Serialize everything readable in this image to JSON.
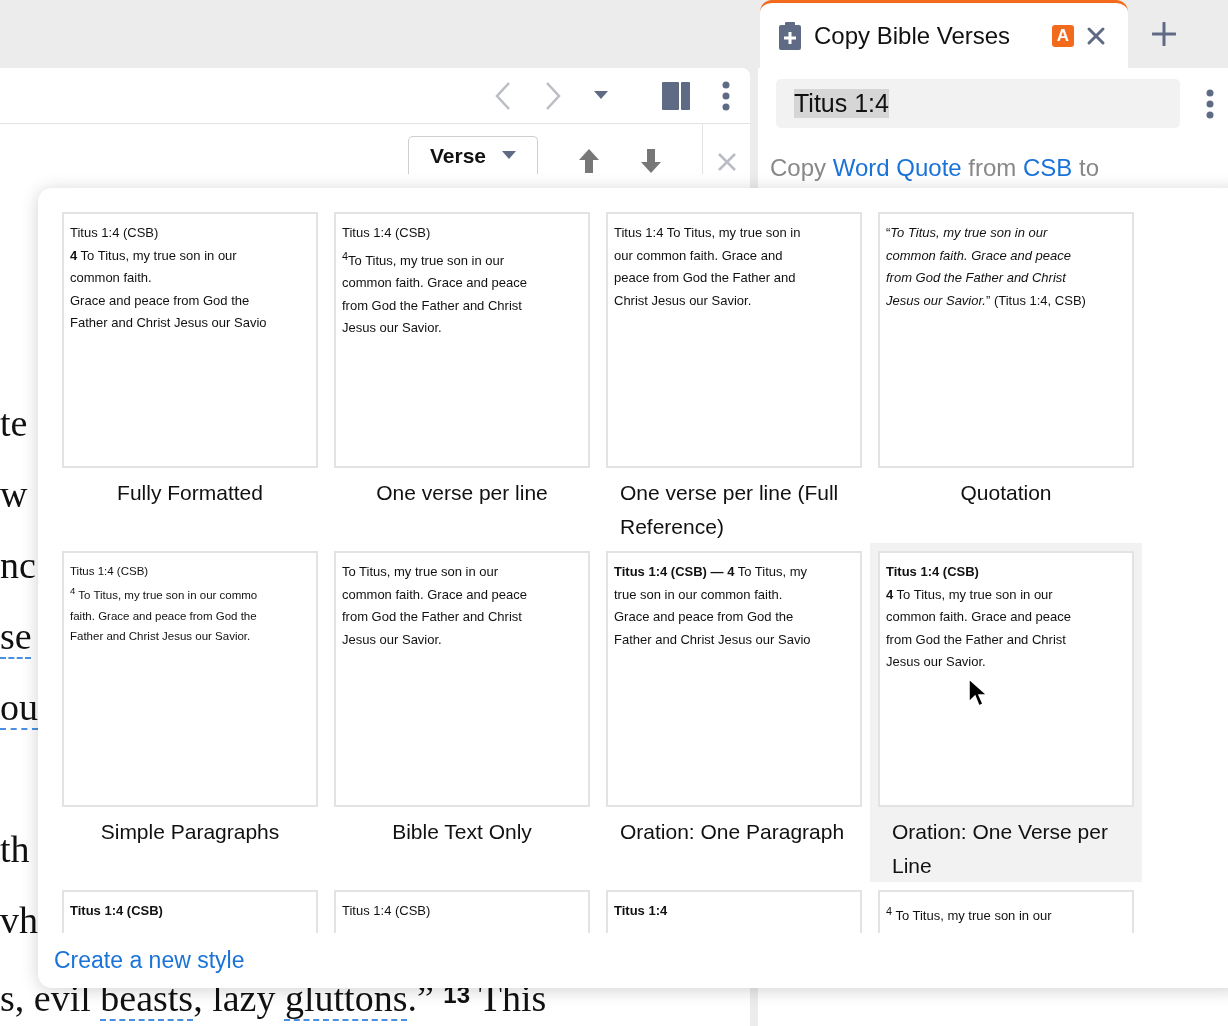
{
  "tab_strip": {
    "tab": {
      "title": "Copy Bible Verses",
      "badge": "A",
      "selected": true
    }
  },
  "left_panel": {
    "verse_dropdown": "Verse",
    "document": {
      "paragraphs": [
        {
          "lines": [
            {
              "text": "te",
              "linked": false
            },
            {
              "text": "w",
              "linked": false
            },
            {
              "text": "nc",
              "linked": false
            },
            {
              "text": "se",
              "linked": true
            },
            {
              "text": "ou",
              "linked": true
            }
          ]
        },
        {
          "lines": [
            {
              "text": "th",
              "linked": false
            },
            {
              "text": "vh",
              "linked": false
            }
          ]
        }
      ],
      "last_line": [
        {
          "text": "s, evil ",
          "kind": "plain"
        },
        {
          "text": "beasts",
          "kind": "link"
        },
        {
          "text": ", lazy ",
          "kind": "plain"
        },
        {
          "text": "gluttons",
          "kind": "link"
        },
        {
          "text": ".” ",
          "kind": "plain"
        },
        {
          "text": "13",
          "kind": "verse"
        },
        {
          "text": " This",
          "kind": "plain"
        }
      ]
    }
  },
  "right_panel": {
    "reference_field": {
      "value": "Titus 1:4",
      "text_selected": true
    },
    "copy_sentence": [
      {
        "text": "Copy",
        "link": false
      },
      {
        "text": "Word Quote",
        "link": true
      },
      {
        "text": "from",
        "link": false
      },
      {
        "text": "CSB",
        "link": true
      },
      {
        "text": "to",
        "link": false
      }
    ]
  },
  "style_picker": {
    "styles": [
      {
        "name": "Fully Formatted",
        "selected": false,
        "compact": false,
        "preview": [
          "Titus 1:4 (CSB)",
          "**4** To Titus, my true son in our",
          "common faith.",
          "Grace and peace from God the",
          "Father and Christ Jesus our Savio"
        ]
      },
      {
        "name": "One verse per line",
        "selected": false,
        "compact": false,
        "preview": [
          "Titus 1:4 (CSB)",
          "$^{4}$To Titus, my true son in our",
          "common faith. Grace and peace",
          "from God the Father and Christ",
          "Jesus our Savior."
        ]
      },
      {
        "name": "One verse per line (Full Reference)",
        "selected": false,
        "compact": false,
        "preview": [
          "Titus 1:4 To Titus, my true son in",
          "our common faith. Grace and",
          "peace from God the Father and",
          "Christ Jesus our Savior."
        ]
      },
      {
        "name": "Quotation",
        "selected": false,
        "compact": false,
        "preview": [
          "“*To Titus, my true son in our*",
          "*common faith. Grace and peace*",
          "*from God the Father and Christ*",
          "*Jesus our Savior.*” (Titus 1:4, CSB)"
        ]
      },
      {
        "name": "Simple Paragraphs",
        "selected": false,
        "compact": true,
        "preview": [
          "Titus 1:4 (CSB)",
          "$^{4}$ To Titus, my true son in our commo",
          "faith. Grace and peace from God the",
          "Father and Christ Jesus our Savior."
        ]
      },
      {
        "name": "Bible Text Only",
        "selected": false,
        "compact": false,
        "preview": [
          "To Titus, my true son in our",
          "common faith. Grace and peace",
          "from God the Father and Christ",
          "Jesus our Savior."
        ]
      },
      {
        "name": "Oration: One Paragraph",
        "selected": false,
        "compact": false,
        "preview": [
          "**Titus 1:4 (CSB) — 4** To Titus, my",
          "true son in our common faith.",
          "Grace and peace from God the",
          "Father and Christ Jesus our Savio"
        ]
      },
      {
        "name": "Oration: One Verse per Line",
        "selected": true,
        "compact": false,
        "preview": [
          "**Titus 1:4 (CSB)**",
          "**4** To Titus, my true son in our",
          "common faith. Grace and peace",
          "from God the Father and Christ",
          "Jesus our Savior."
        ]
      },
      {
        "selected": false,
        "compact": false,
        "preview": [
          "**Titus 1:4 (CSB)**"
        ]
      },
      {
        "selected": false,
        "compact": false,
        "preview": [
          "Titus 1:4 (CSB)"
        ]
      },
      {
        "selected": false,
        "compact": false,
        "preview": [
          "**Titus 1:4**"
        ]
      },
      {
        "selected": false,
        "compact": false,
        "preview": [
          "$^{4}$ To Titus, my true son in our"
        ]
      }
    ],
    "footer_link": "Create a new style"
  }
}
